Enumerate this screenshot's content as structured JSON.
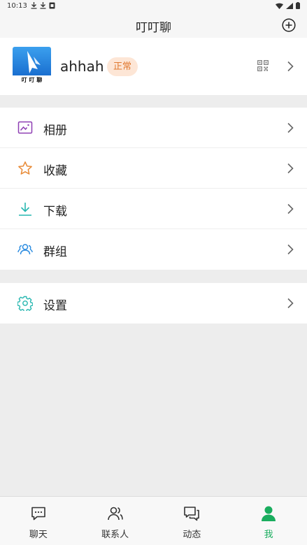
{
  "status_bar": {
    "time": "10:13",
    "left_icons": [
      "download-icon",
      "download-icon",
      "notification-icon"
    ],
    "right_icons": [
      "wifi-icon",
      "signal-icon",
      "battery-icon"
    ]
  },
  "header": {
    "title": "叮叮聊",
    "add_icon": "plus-circle-icon"
  },
  "profile": {
    "avatar_text": "叮 叮 聊",
    "username": "ahhah",
    "badge": "正常",
    "badge_color": "#e0782f"
  },
  "menu_groups": [
    [
      {
        "label": "相册",
        "icon": "album-icon",
        "color": "#8e3fb3"
      },
      {
        "label": "收藏",
        "icon": "star-icon",
        "color": "#e88a36"
      },
      {
        "label": "下载",
        "icon": "download-icon",
        "color": "#27b7b0"
      },
      {
        "label": "群组",
        "icon": "group-icon",
        "color": "#2a8be0"
      }
    ],
    [
      {
        "label": "设置",
        "icon": "gear-icon",
        "color": "#27b7b0"
      }
    ]
  ],
  "tabs": [
    {
      "label": "聊天",
      "icon": "chat-icon",
      "active": false
    },
    {
      "label": "联系人",
      "icon": "contacts-icon",
      "active": false
    },
    {
      "label": "动态",
      "icon": "moments-icon",
      "active": false
    },
    {
      "label": "我",
      "icon": "user-icon",
      "active": true
    }
  ],
  "accent_color": "#1aad5e"
}
